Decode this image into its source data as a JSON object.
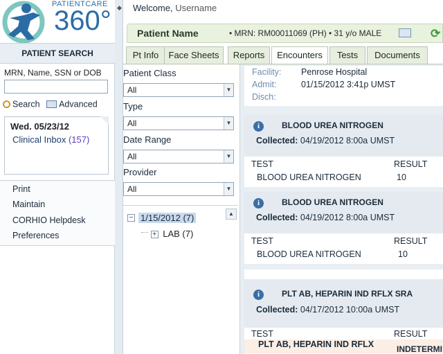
{
  "logo": {
    "small_text": "PATIENTCARE",
    "big_text": "360°"
  },
  "sidebar": {
    "search_heading": "PATIENT SEARCH",
    "search_hint": "MRN, Name, SSN or DOB",
    "search_value": "",
    "search_link": "Search",
    "advanced_link": "Advanced",
    "inbox_date": "Wed. 05/23/12",
    "inbox_label": "Clinical Inbox",
    "inbox_count": "(157)",
    "nav": [
      "Print",
      "Maintain",
      "CORHIO Helpdesk",
      "Preferences"
    ]
  },
  "header": {
    "welcome": "Welcome,",
    "username": "Username",
    "patient_name": "Patient Name",
    "patient_info": "• MRN: RM00011069 (PH) • 31 y/o MALE"
  },
  "tabs": [
    "Pt Info",
    "Face Sheets",
    "Reports",
    "Encounters",
    "Tests",
    "Documents"
  ],
  "active_tab": "Encounters",
  "filters": [
    {
      "label": "Patient Class",
      "value": "All"
    },
    {
      "label": "Type",
      "value": "All"
    },
    {
      "label": "Date Range",
      "value": "All"
    },
    {
      "label": "Provider",
      "value": "All"
    }
  ],
  "tree": {
    "root_toggle": "−",
    "root_label": "1/15/2012 (7)",
    "child_toggle": "+",
    "child_label": "LAB (7)"
  },
  "facility": {
    "facility_key": "Facility:",
    "facility_val": "Penrose Hospital",
    "admit_key": "Admit:",
    "admit_val": "01/15/2012 3:41p UMST",
    "disch_key": "Disch:"
  },
  "cards": [
    {
      "title": "BLOOD UREA NITROGEN",
      "collected_key": "Collected:",
      "collected_val": "04/19/2012 8:00a UMST",
      "col_test": "TEST",
      "col_result": "RESULT",
      "row_test": "BLOOD UREA NITROGEN",
      "row_result": "10"
    },
    {
      "title": "BLOOD UREA NITROGEN",
      "collected_key": "Collected:",
      "collected_val": "04/19/2012 8:00a UMST",
      "col_test": "TEST",
      "col_result": "RESULT",
      "row_test": "BLOOD UREA NITROGEN",
      "row_result": "10"
    },
    {
      "title": "PLT AB, HEPARIN IND RFLX SRA",
      "collected_key": "Collected:",
      "collected_val": "04/17/2012 10:00a UMST",
      "col_test": "TEST",
      "col_result": "RESULT",
      "row_test": "PLT AB, HEPARIN IND RFLX",
      "row_result": "INDETERMI"
    }
  ],
  "colors": {
    "accent": "#2c6ca6",
    "tab_bg": "#e7eedf",
    "patient_bar": "#e9f1df",
    "info_icon": "#3a6ea8"
  }
}
